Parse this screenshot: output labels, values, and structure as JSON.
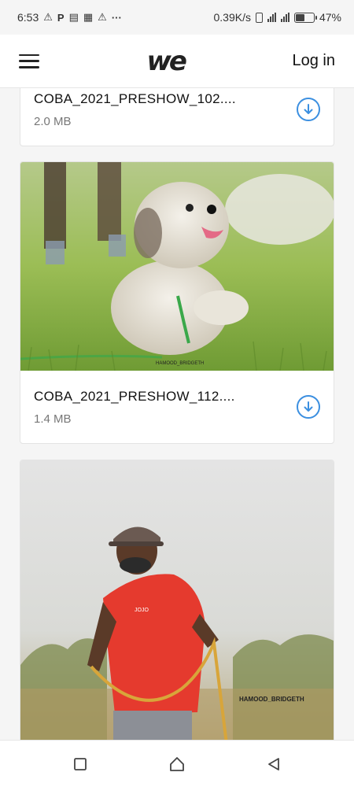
{
  "status_bar": {
    "time": "6:53",
    "left_glyphs": [
      "⚠",
      "P",
      "▤",
      "▦",
      "⚠",
      "···"
    ],
    "network_speed": "0.39K/s",
    "battery_percent": "47%",
    "battery_level": 0.47
  },
  "header": {
    "logo_text": "we",
    "login_label": "Log in"
  },
  "files": [
    {
      "name": "COBA_2021_PRESHOW_102....",
      "size": "2.0 MB"
    },
    {
      "name": "COBA_2021_PRESHOW_112....",
      "size": "1.4 MB",
      "watermark": "HAMOOD_BRIDGETH"
    },
    {
      "watermark": "HAMOOD_BRIDGETH",
      "shirt_text": "JOJO"
    }
  ],
  "colors": {
    "accent": "#3b8fe0",
    "shirt": "#e53a2e",
    "grass": "#8fb64a"
  }
}
